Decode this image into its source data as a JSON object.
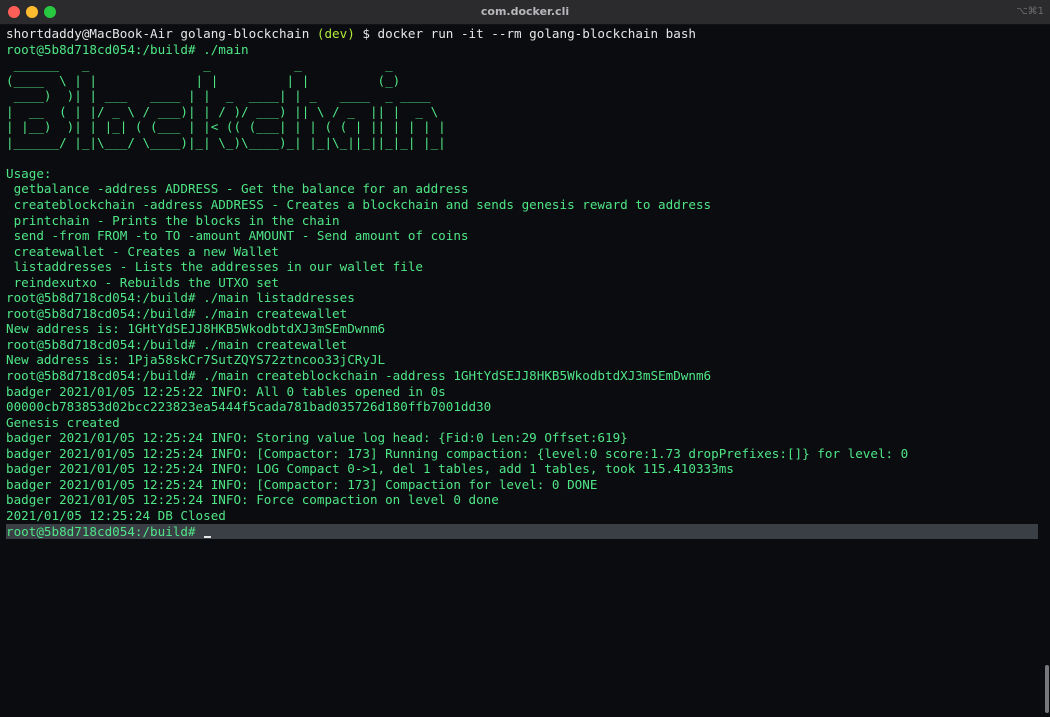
{
  "window": {
    "title": "com.docker.cli",
    "shortcut": "⌥⌘1"
  },
  "terminal": {
    "prompt_line": {
      "user_host": "shortdaddy@MacBook-Air golang-blockchain ",
      "branch": "(dev)",
      "command": " $ docker run -it --rm golang-blockchain bash"
    },
    "run_main": "root@5b8d718cd054:/build# ./main",
    "ascii_art": [
      " ______   _               _           _           _",
      "(____  \\ | |             | |         | |         (_)",
      " ____)  )| | ___   ____ | |  _  ____| | _   ____  _ ____",
      "|  __  ( | |/ _ \\ / ___)| | / )/ ___) || \\ / _  || |  _ \\",
      "| |__)  )| | |_| ( (___ | |< (( (___| | | ( ( | || | | | |",
      "|______/ |_|\\___/ \\____)|_| \\_)\\____)_| |_|\\_||_||_|_| |_|"
    ],
    "usage_header": "Usage:",
    "usage_lines": [
      " getbalance -address ADDRESS - Get the balance for an address",
      " createblockchain -address ADDRESS - Creates a blockchain and sends genesis reward to address",
      " printchain - Prints the blocks in the chain",
      " send -from FROM -to TO -amount AMOUNT - Send amount of coins",
      " createwallet - Creates a new Wallet",
      " listaddresses - Lists the addresses in our wallet file",
      " reindexutxo - Rebuilds the UTXO set"
    ],
    "session_lines": [
      "root@5b8d718cd054:/build# ./main listaddresses",
      "root@5b8d718cd054:/build# ./main createwallet",
      "New address is: 1GHtYdSEJJ8HKB5WkodbtdXJ3mSEmDwnm6",
      "root@5b8d718cd054:/build# ./main createwallet",
      "New address is: 1Pja58skCr7SutZQYS72ztncoo33jCRyJL",
      "root@5b8d718cd054:/build# ./main createblockchain -address 1GHtYdSEJJ8HKB5WkodbtdXJ3mSEmDwnm6",
      "badger 2021/01/05 12:25:22 INFO: All 0 tables opened in 0s",
      "00000cb783853d02bcc223823ea5444f5cada781bad035726d180ffb7001dd30",
      "Genesis created",
      "badger 2021/01/05 12:25:24 INFO: Storing value log head: {Fid:0 Len:29 Offset:619}",
      "badger 2021/01/05 12:25:24 INFO: [Compactor: 173] Running compaction: {level:0 score:1.73 dropPrefixes:[]} for level: 0",
      "badger 2021/01/05 12:25:24 INFO: LOG Compact 0->1, del 1 tables, add 1 tables, took 115.410333ms",
      "badger 2021/01/05 12:25:24 INFO: [Compactor: 173] Compaction for level: 0 DONE",
      "badger 2021/01/05 12:25:24 INFO: Force compaction on level 0 done",
      "2021/01/05 12:25:24 DB Closed"
    ],
    "current_prompt": "root@5b8d718cd054:/build# "
  },
  "colors": {
    "output_green": "#4fe687",
    "branch_green": "#b3ec3c",
    "prompt_white": "#e6e6e6",
    "current_line_highlight": "#3a3f46"
  }
}
